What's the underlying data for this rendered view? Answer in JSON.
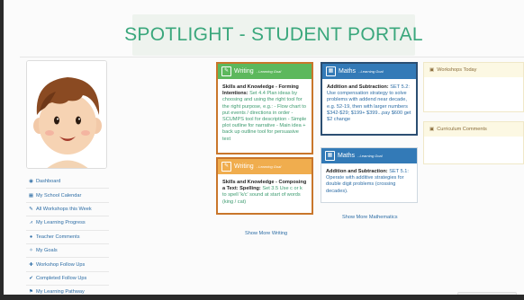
{
  "header": {
    "title": "SPOTLIGHT - STUDENT PORTAL"
  },
  "sidebar": {
    "items": [
      {
        "icon": "dashboard-icon",
        "glyph": "◉",
        "label": "Dashboard"
      },
      {
        "icon": "calendar-icon",
        "glyph": "▦",
        "label": "My School Calendar"
      },
      {
        "icon": "wrench-icon",
        "glyph": "✎",
        "label": "All Workshops this Week"
      },
      {
        "icon": "chart-line-icon",
        "glyph": "⩘",
        "label": "My Learning Progress"
      },
      {
        "icon": "comments-icon",
        "glyph": "●",
        "label": "Teacher Comments"
      },
      {
        "icon": "target-icon",
        "glyph": "✧",
        "label": "My Goals"
      },
      {
        "icon": "plus-icon",
        "glyph": "✚",
        "label": "Workshop Follow Ups"
      },
      {
        "icon": "check-circle-icon",
        "glyph": "✔",
        "label": "Completed Follow Ups"
      },
      {
        "icon": "road-icon",
        "glyph": "⚑",
        "label": "My Learning Pathway"
      }
    ]
  },
  "cards": {
    "writing1": {
      "title": "Writing",
      "subtitle": "- Learning Goal",
      "heading": "Skills and Knowledge - Forming Intentions:",
      "body": "Set 4.4 Plan ideas by choosing and using the right tool for the right purpose, e.g.: - Flow chart to put events / directions in order - SCUMPS tool for description - Simple plot outline for narrative - Main idea + back up outline tool for persuasive text"
    },
    "writing2": {
      "title": "Writing",
      "subtitle": "- Learning Goal",
      "heading": "Skills and Knowledge - Composing a Text: Spelling:",
      "body": "Set 3.5 Use c or k to spell 'k/c' sound at start of words (king / cat)"
    },
    "maths1": {
      "title": "Maths",
      "subtitle": "- Learning Goal",
      "heading": "Addition and Subtraction:",
      "body": "SET 5.2: Use compensation strategy to solve problems with addend near decade, e.g. 52-19, then with larger numbers $342-$29; $199+ $399...pay $600 get $2 change"
    },
    "maths2": {
      "title": "Maths",
      "subtitle": "- Learning Goal",
      "heading": "Addition and Subtraction:",
      "body": "SET 5.1: Operate with additive strategies for double digit problems (crossing decades)."
    }
  },
  "links": {
    "show_more_writing": "Show More Writing",
    "show_more_maths": "Show More Mathematics"
  },
  "panels": {
    "workshops_today": "Workshops Today",
    "curriculum_comments": "Curriculum Comments"
  },
  "colors": {
    "brand_green": "#3aa77c",
    "writing_green": "#5cb85c",
    "writing_orange": "#f0ad4e",
    "maths_blue": "#337ab7",
    "highlight_border": "#c9762b",
    "link_blue": "#2d6da5"
  }
}
